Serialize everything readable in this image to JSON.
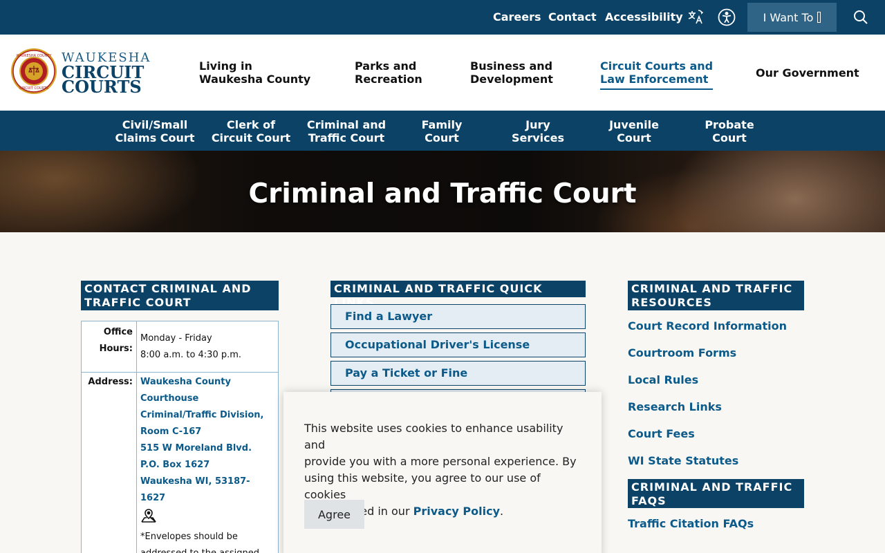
{
  "topbar": {
    "links": [
      "Careers",
      "Contact",
      "Accessibility"
    ],
    "iwant_label": "I Want To",
    "icons": [
      "translate-icon",
      "accessibility-icon",
      "search-icon"
    ]
  },
  "logo": {
    "line1": "WAUKESHA",
    "line2": "CIRCUIT",
    "line3": "COURTS",
    "seal_text_top": "WAUKESHA COUNTY",
    "seal_text_bottom": "CIRCUIT COURTS"
  },
  "mainnav": {
    "items": [
      {
        "line1": "Living in",
        "line2": "Waukesha County"
      },
      {
        "line1": "Parks and",
        "line2": "Recreation"
      },
      {
        "line1": "Business and",
        "line2": "Development"
      },
      {
        "line1": "Circuit Courts and",
        "line2": "Law Enforcement"
      },
      {
        "line1": "Our Government",
        "line2": ""
      }
    ],
    "active_index": 3
  },
  "subnav": {
    "items": [
      {
        "line1": "Civil/Small",
        "line2": "Claims Court"
      },
      {
        "line1": "Clerk of",
        "line2": "Circuit Court"
      },
      {
        "line1": "Criminal and",
        "line2": "Traffic Court"
      },
      {
        "line1": "Family",
        "line2": "Court"
      },
      {
        "line1": "Jury",
        "line2": "Services"
      },
      {
        "line1": "Juvenile",
        "line2": "Court"
      },
      {
        "line1": "Probate",
        "line2": "Court"
      }
    ]
  },
  "hero": {
    "title": "Criminal and Traffic Court"
  },
  "contact": {
    "heading_line1": "CONTACT CRIMINAL AND",
    "heading_line2": "TRAFFIC COURT",
    "office_hours_label_1": "Office",
    "office_hours_label_2": "Hours:",
    "office_hours_1": "Monday - Friday",
    "office_hours_2": "8:00 a.m. to 4:30 p.m.",
    "address_label": "Address:",
    "address_lines": [
      "Waukesha County",
      "Courthouse",
      "Criminal/Traffic Division,",
      "Room C-167",
      "515 W Moreland Blvd.",
      "P.O. Box 1627",
      "Waukesha WI, 53187-1627"
    ],
    "note_1": "*Envelopes should be",
    "note_2": "addressed to the assigned",
    "map_icon": "map-pin-icon"
  },
  "quick_links": {
    "heading": "CRIMINAL AND TRAFFIC QUICK LINKS",
    "items": [
      "Find a Lawyer",
      "Occupational Driver's License",
      "Pay a Ticket or Fine"
    ]
  },
  "resources": {
    "heading_line1": "CRIMINAL AND TRAFFIC",
    "heading_line2": "RESOURCES",
    "items": [
      "Court Record Information",
      "Courtroom Forms",
      "Local Rules",
      "Research Links",
      "Court Fees",
      "WI State Statutes"
    ]
  },
  "faqs": {
    "heading_line1": "CRIMINAL AND TRAFFIC",
    "heading_line2": "FAQS",
    "items": [
      "Traffic Citation FAQs"
    ]
  },
  "cookie": {
    "text_1": "This website uses cookies to enhance usability and",
    "text_2": "provide you with a more personal experience. By",
    "text_3": "using this website, you agree to our use of cookies",
    "text_4": "as explained in our",
    "link": "Privacy Policy",
    "text_end": ".",
    "agree_label": "Agree"
  },
  "colors": {
    "primary": "#0b4266",
    "link": "#0b5a8a",
    "background": "#f8f7f3",
    "quicklink_bg": "#e4edf3"
  }
}
